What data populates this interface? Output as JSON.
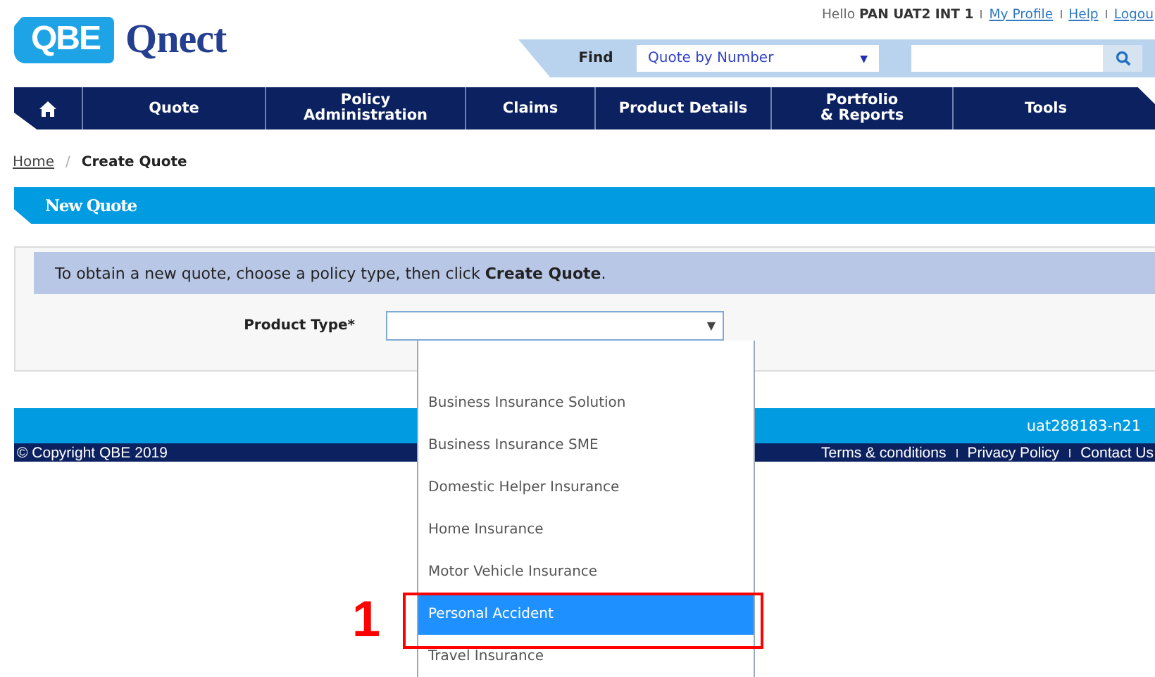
{
  "header": {
    "logo": {
      "mark": "QBE",
      "name": "Qnect"
    },
    "greeting": "Hello",
    "user": "PAN UAT2 INT 1",
    "links": [
      "My Profile",
      "Help",
      "Logou"
    ]
  },
  "find": {
    "label": "Find",
    "select_value": "Quote by Number",
    "caret": "▼"
  },
  "nav": [
    {
      "kind": "home"
    },
    {
      "kind": "text",
      "label": "Quote"
    },
    {
      "kind": "text",
      "label": "Policy\nAdministration"
    },
    {
      "kind": "text",
      "label": "Claims"
    },
    {
      "kind": "text",
      "label": "Product Details"
    },
    {
      "kind": "text",
      "label": "Portfolio\n& Reports"
    },
    {
      "kind": "text",
      "label": "Tools"
    }
  ],
  "breadcrumb": [
    "Home",
    "Create Quote"
  ],
  "breadcrumb_separator": "/",
  "section_title": "New Quote",
  "instruction": "To obtain a new quote, choose a policy type, then click **Create Quote**.",
  "product_type": {
    "label": "Product Type*",
    "caret": "▼",
    "expanded": true,
    "options": [
      {
        "label": "Business Insurance Solution",
        "selected": false
      },
      {
        "label": "Business Insurance SME",
        "selected": false
      },
      {
        "label": "Domestic Helper Insurance",
        "selected": false
      },
      {
        "label": "Home Insurance",
        "selected": false
      },
      {
        "label": "Motor Vehicle Insurance",
        "selected": false
      },
      {
        "label": "Personal Accident",
        "selected": true
      },
      {
        "label": "Travel Insurance",
        "selected": false
      }
    ]
  },
  "footer": {
    "version": "uat288183-n21",
    "copyright": "© Copyright QBE 2019",
    "links": [
      "Terms & conditions",
      "Privacy Policy",
      "Contact Us"
    ]
  },
  "annotation": {
    "label": "1"
  }
}
